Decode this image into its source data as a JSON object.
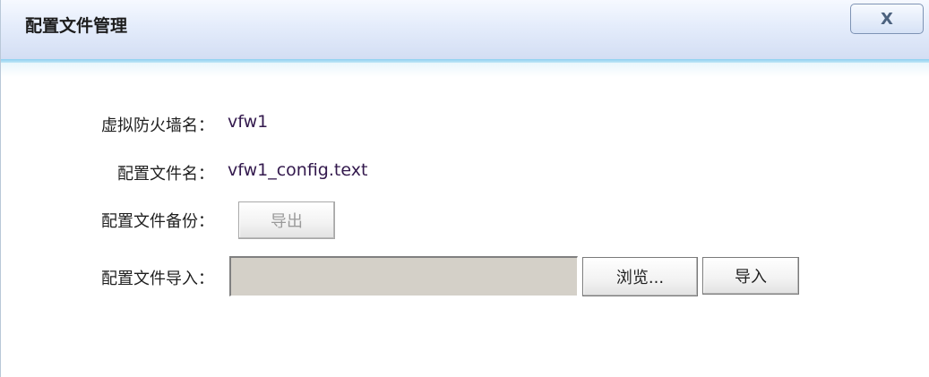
{
  "window": {
    "title": "配置文件管理",
    "close_label": "X"
  },
  "form": {
    "vfw_name_label": "虚拟防火墙名：",
    "vfw_name_value": "vfw1",
    "config_file_label": "配置文件名：",
    "config_file_value": "vfw1_config.text",
    "backup_label": "配置文件备份：",
    "export_button": "导出",
    "import_label": "配置文件导入：",
    "import_file_value": "",
    "browse_button": "浏览...",
    "import_button": "导入"
  }
}
